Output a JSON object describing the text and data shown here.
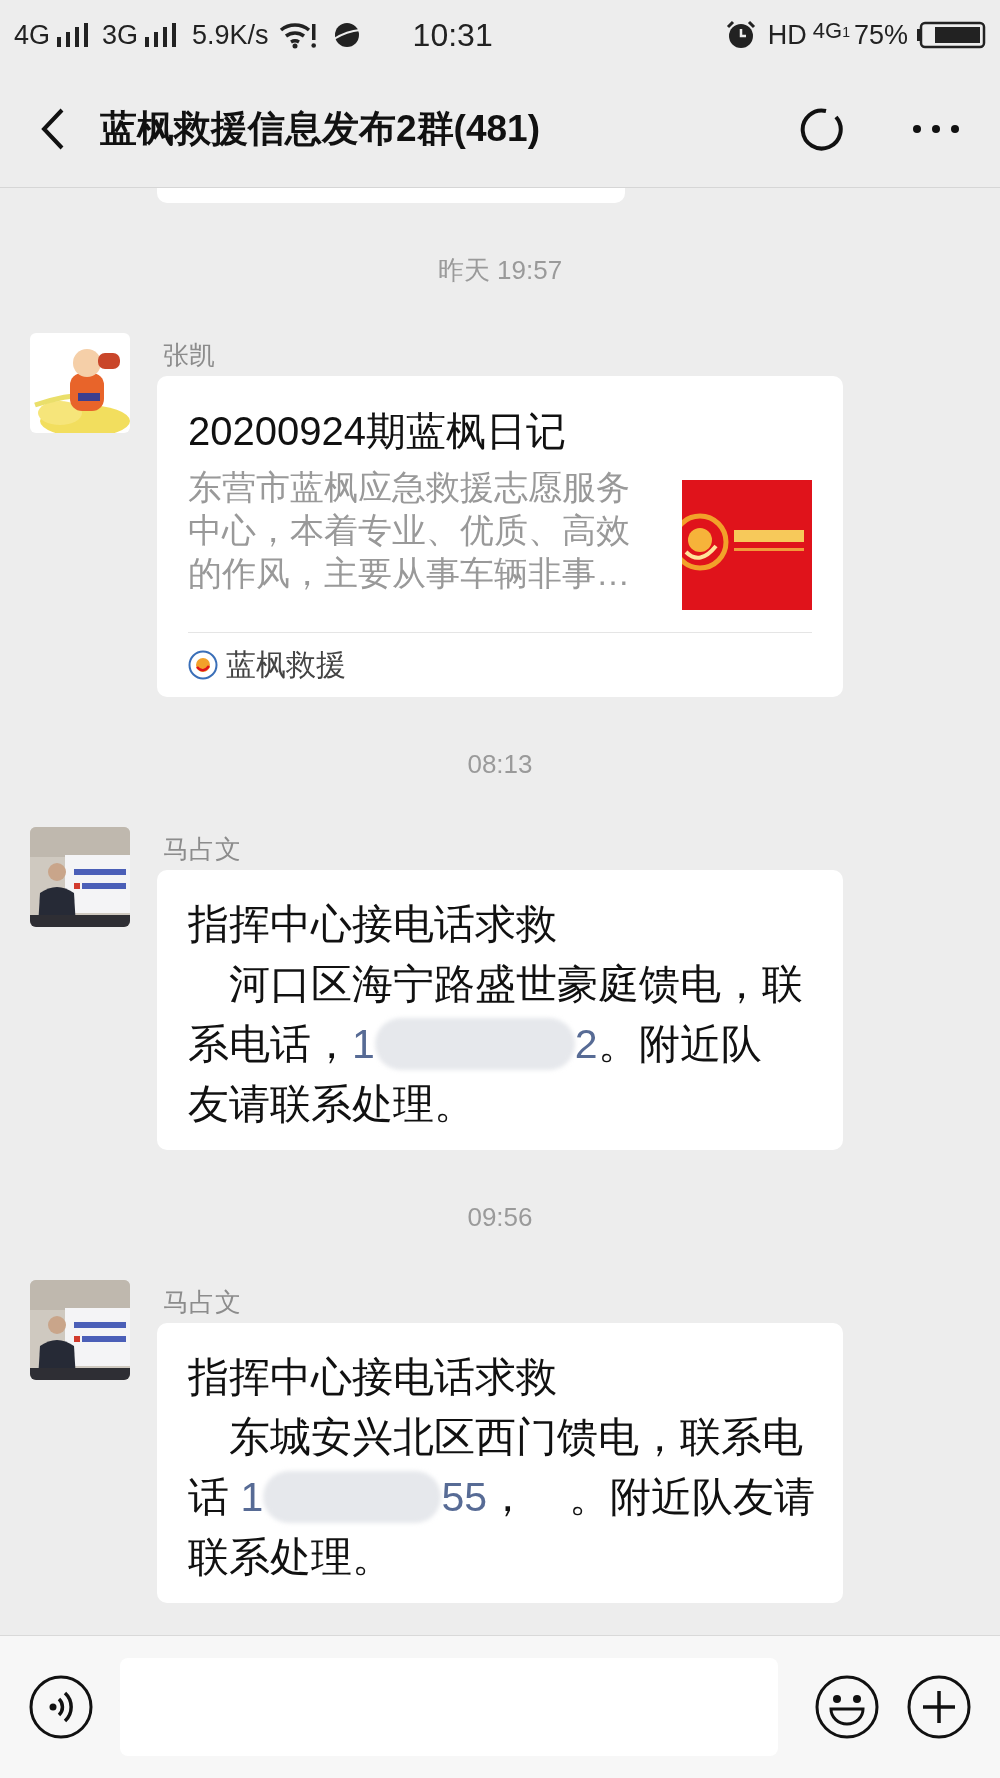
{
  "status_bar": {
    "signal_1": "4G",
    "signal_2": "3G",
    "speed": "5.9K/s",
    "time": "10:31",
    "hd": "HD",
    "network": "4G",
    "sim": "1",
    "battery": "75%"
  },
  "header": {
    "title": "蓝枫救援信息发布2群(481)"
  },
  "messages": [
    {
      "kind": "time",
      "text": "昨天 19:57"
    },
    {
      "kind": "link_card",
      "sender": "张凯",
      "title": "20200924期蓝枫日记",
      "description": "东营市蓝枫应急救援志愿服务中心，本着专业、优质、高效的作风，主要从事车辆非事…",
      "source": "蓝枫救援"
    },
    {
      "kind": "time",
      "text": "08:13"
    },
    {
      "kind": "text",
      "sender": "马占文",
      "title": "指挥中心接电话求救",
      "body": [
        [
          {
            "kind": "plain",
            "text": "　河口区海宁路盛世豪庭馈电，联"
          }
        ],
        [
          {
            "kind": "plain",
            "text": "系电话，"
          },
          {
            "kind": "link",
            "text": "1"
          },
          {
            "kind": "redaction"
          },
          {
            "kind": "link",
            "text": "2"
          },
          {
            "kind": "plain",
            "text": "。附近队"
          }
        ],
        [
          {
            "kind": "plain",
            "text": "友请联系处理。"
          }
        ]
      ]
    },
    {
      "kind": "time",
      "text": "09:56"
    },
    {
      "kind": "text",
      "sender": "马占文",
      "title": "指挥中心接电话求救",
      "body": [
        [
          {
            "kind": "plain",
            "text": "　东城安兴北区西门馈电，联系电"
          }
        ],
        [
          {
            "kind": "plain",
            "text": "话 "
          },
          {
            "kind": "link",
            "text": "1"
          },
          {
            "kind": "redaction"
          },
          {
            "kind": "link",
            "text": "55"
          },
          {
            "kind": "plain",
            "text": "，　。附近队友请"
          }
        ],
        [
          {
            "kind": "plain",
            "text": "联系处理。"
          }
        ]
      ]
    }
  ]
}
